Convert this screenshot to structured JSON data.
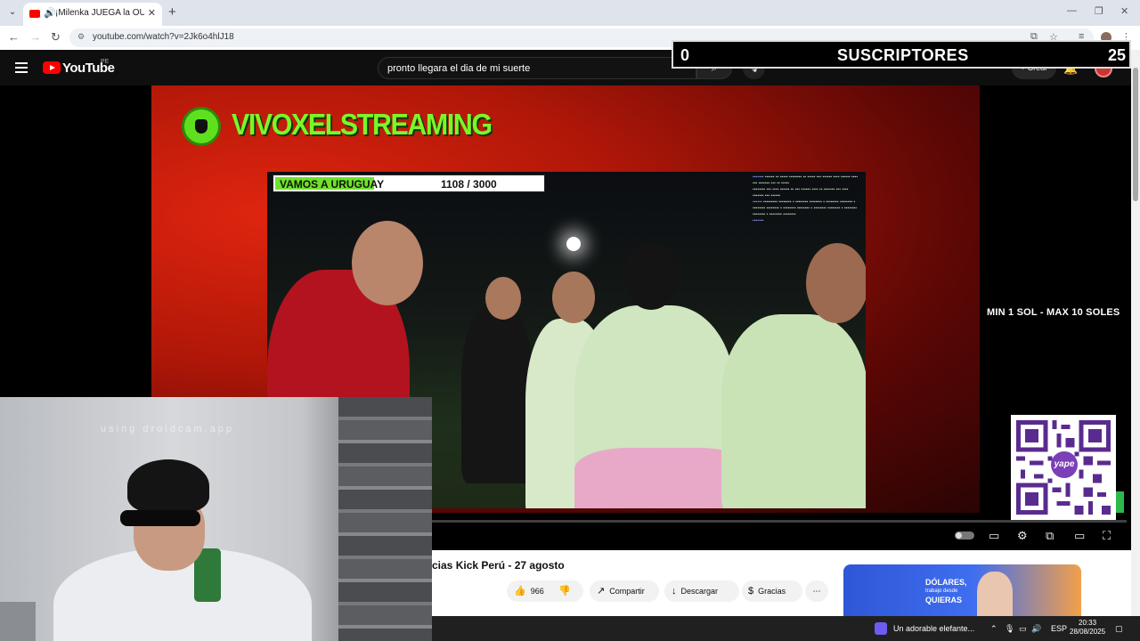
{
  "browser": {
    "tab_title": "¡Milenka JUEGA la OUIJA y...",
    "url": "youtube.com/watch?v=2Jk6o4hlJ18"
  },
  "masthead": {
    "logo_text": "YouTube",
    "country_code": "PE",
    "search_query": "pronto llegara el dia de mi suerte",
    "create_label": "Crear"
  },
  "overlay": {
    "subs_left": "0",
    "subs_label": "SUSCRIPTORES",
    "subs_right": "25",
    "brand": "VIVOXELSTREAMING",
    "goal_label": "VAMOS A URUGUAY",
    "goal_value": "1108 / 3000",
    "goal_progress": 0.37,
    "donation_range": "MIN 1 SOL - MAX 10 SOLES",
    "yape_label": "yape",
    "webcam_watermark": "using droidcam.app"
  },
  "video": {
    "title": "cias Kick Perú - 27 agosto",
    "likes": "966",
    "share_label": "Compartir",
    "download_label": "Descargar",
    "thanks_label": "Gracias"
  },
  "ad": {
    "line1": "DÓLARES,",
    "line2": "trabajo desde",
    "line3": "QUIERAS"
  },
  "taskbar": {
    "media_title": "Un adorable elefante...",
    "language": "ESP",
    "time": "20:33",
    "date": "28/08/2025"
  }
}
